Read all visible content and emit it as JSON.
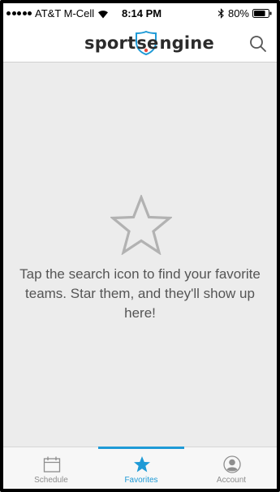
{
  "status_bar": {
    "carrier": "AT&T M-Cell",
    "time": "8:14 PM",
    "battery": "80%",
    "battery_level": 0.8
  },
  "header": {
    "logo_left": "sport",
    "logo_mark": "se",
    "logo_right": "ngine",
    "search_icon": "search-icon"
  },
  "main": {
    "empty_icon": "star-outline-icon",
    "message": "Tap the search icon to find your favorite teams. Star them, and they'll show up here!"
  },
  "tabs": [
    {
      "label": "Schedule",
      "icon": "calendar-icon",
      "active": false
    },
    {
      "label": "Favorites",
      "icon": "star-icon",
      "active": true
    },
    {
      "label": "Account",
      "icon": "account-icon",
      "active": false
    }
  ],
  "colors": {
    "accent": "#1e9ad6",
    "background": "#ececec",
    "text_muted": "#555555",
    "tab_inactive": "#8e8e8e"
  }
}
